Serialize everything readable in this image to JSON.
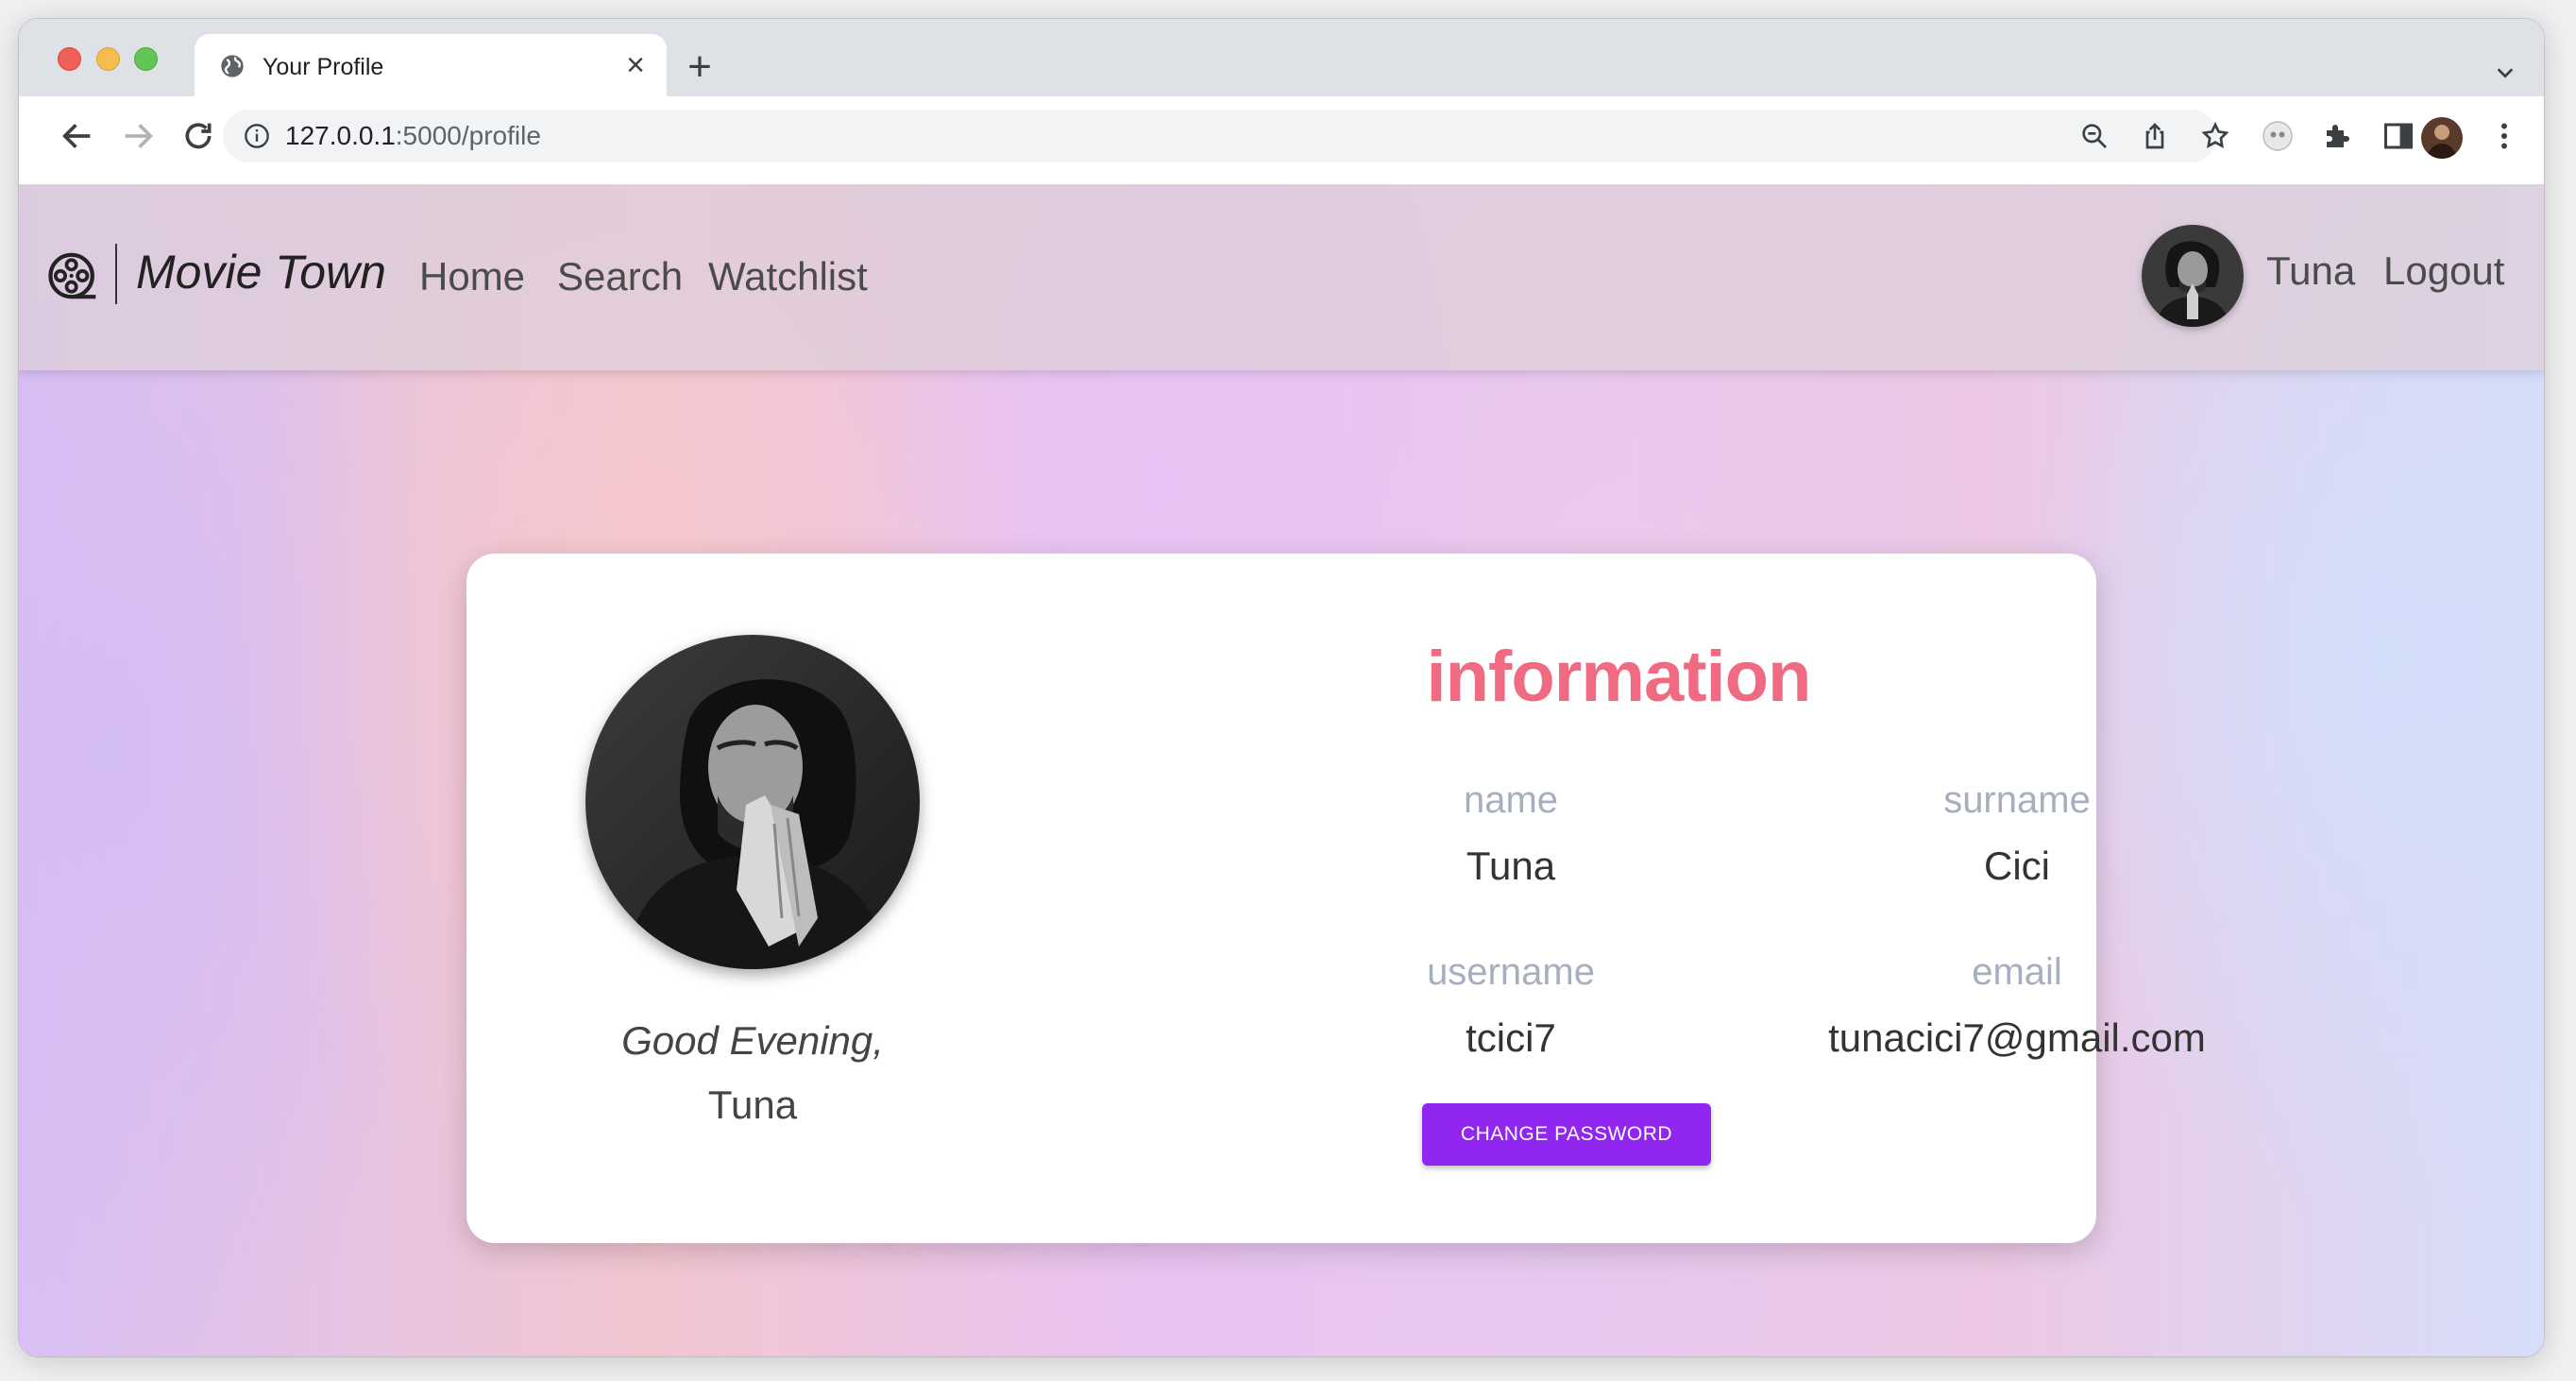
{
  "browser": {
    "tab_title": "Your Profile",
    "url_host": "127.0.0.1",
    "url_path": ":5000/profile"
  },
  "navbar": {
    "brand": "Movie Town",
    "links": [
      "Home",
      "Search",
      "Watchlist"
    ],
    "user_name": "Tuna",
    "logout": "Logout"
  },
  "profile": {
    "greeting": "Good Evening,",
    "greet_name": "Tuna",
    "section_title": "information",
    "fields": [
      {
        "label": "name",
        "value": "Tuna"
      },
      {
        "label": "surname",
        "value": "Cici"
      },
      {
        "label": "username",
        "value": "tcici7"
      },
      {
        "label": "email",
        "value": "tunacici7@gmail.com"
      }
    ],
    "change_password": "CHANGE PASSWORD"
  },
  "colors": {
    "accent_button": "#9126f0",
    "title_pink": "#f06b82",
    "label_gray": "#a6afbf"
  },
  "icons": [
    "globe-icon",
    "close-icon",
    "plus-icon",
    "chevron-down-icon",
    "back-icon",
    "forward-icon",
    "reload-icon",
    "info-icon",
    "zoom-out-icon",
    "share-icon",
    "star-icon",
    "extension-icon",
    "puzzle-icon",
    "sidepanel-icon",
    "more-icon",
    "film-reel-icon"
  ]
}
